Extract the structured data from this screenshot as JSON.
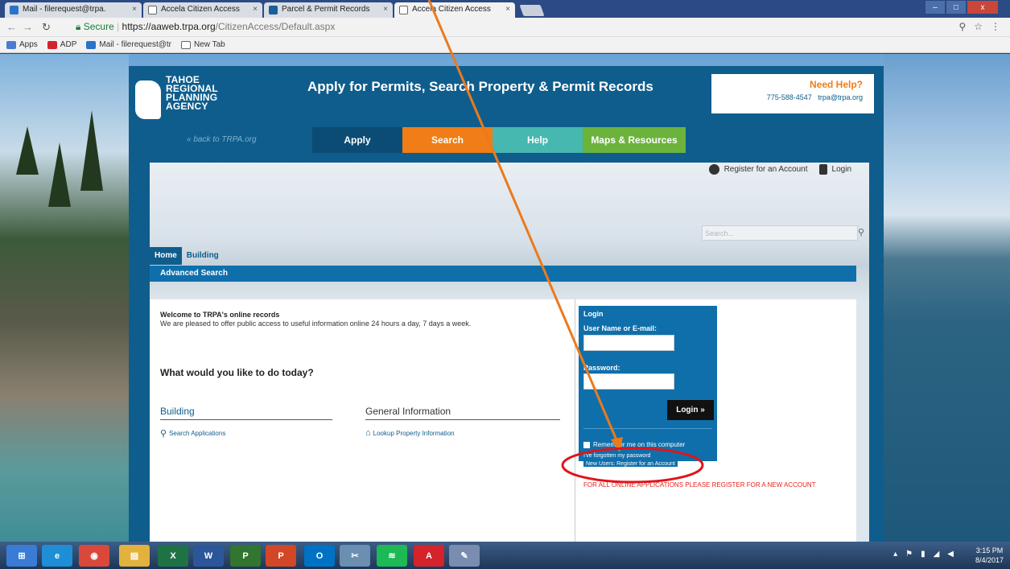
{
  "browser": {
    "tabs": [
      {
        "label": "Mail - filerequest@trpa.",
        "close": "×"
      },
      {
        "label": "Accela Citizen Access",
        "close": "×"
      },
      {
        "label": "Parcel & Permit Records",
        "close": "×"
      },
      {
        "label": "Accela Citizen Access",
        "close": "×"
      }
    ],
    "address": {
      "secure_label": "Secure",
      "host": "https://aaweb.trpa.org",
      "path": "/CitizenAccess/Default.aspx"
    },
    "bookmarks": [
      "Apps",
      "ADP",
      "Mail - filerequest@tr",
      "New Tab"
    ],
    "window_controls": [
      "–",
      "□",
      "x"
    ]
  },
  "site": {
    "logo_lines": [
      "TAHOE",
      "REGIONAL",
      "PLANNING",
      "AGENCY"
    ],
    "back_link": "« back to TRPA.org",
    "hero_title": "Apply for Permits, Search Property & Permit Records",
    "help": {
      "title": "Need Help?",
      "phone": "775-588-4547",
      "email": "trpa@trpa.org"
    },
    "nav_tabs": [
      {
        "label": "Apply",
        "color": "#0b4c75"
      },
      {
        "label": "Search",
        "color": "#f07d17"
      },
      {
        "label": "Help",
        "color": "#46b8b0"
      },
      {
        "label": "Maps & Resources",
        "color": "#6cb33e"
      }
    ],
    "register_link": "Register for an Account",
    "login_link": "Login",
    "search_placeholder": "Search...",
    "module_tabs": [
      "Home",
      "Building"
    ],
    "advanced_search": "Advanced Search",
    "welcome_title": "Welcome to TRPA's online records",
    "welcome_text": "We are pleased to offer public access to useful information online 24 hours a day, 7 days a week.",
    "question": "What would you like to do today?",
    "building": {
      "heading": "Building",
      "link": "Search Applications"
    },
    "general": {
      "heading": "General Information",
      "link": "Lookup Property Information"
    },
    "login_box": {
      "title": "Login",
      "username_label": "User Name or E-mail:",
      "password_label": "Password:",
      "button": "Login »",
      "remember": "Remember me on this computer",
      "forgot": "I've forgotten my password",
      "new_users": "New Users: Register for an Account"
    },
    "notice": "FOR ALL ONLINE APPLICATIONS PLEASE REGISTER FOR A NEW ACCOUNT"
  },
  "taskbar": {
    "apps": [
      {
        "name": "start",
        "color": "#3a7bd5",
        "glyph": "⊞"
      },
      {
        "name": "ie",
        "color": "#1e8fd6",
        "glyph": "e"
      },
      {
        "name": "chrome",
        "color": "#d9483b",
        "glyph": "◉"
      },
      {
        "name": "explorer",
        "color": "#e2b23c",
        "glyph": "▤"
      },
      {
        "name": "excel",
        "color": "#1f7244",
        "glyph": "X"
      },
      {
        "name": "word",
        "color": "#2b579a",
        "glyph": "W"
      },
      {
        "name": "project",
        "color": "#31752f",
        "glyph": "P"
      },
      {
        "name": "powerpoint",
        "color": "#d24726",
        "glyph": "P"
      },
      {
        "name": "outlook",
        "color": "#0072c6",
        "glyph": "O"
      },
      {
        "name": "snipping",
        "color": "#6a8fb0",
        "glyph": "✂"
      },
      {
        "name": "spotify",
        "color": "#1db954",
        "glyph": "≋"
      },
      {
        "name": "acrobat",
        "color": "#d4232b",
        "glyph": "A"
      },
      {
        "name": "paint",
        "color": "#7a8db0",
        "glyph": "✎"
      }
    ],
    "time": "3:15 PM",
    "date": "8/4/2017"
  }
}
